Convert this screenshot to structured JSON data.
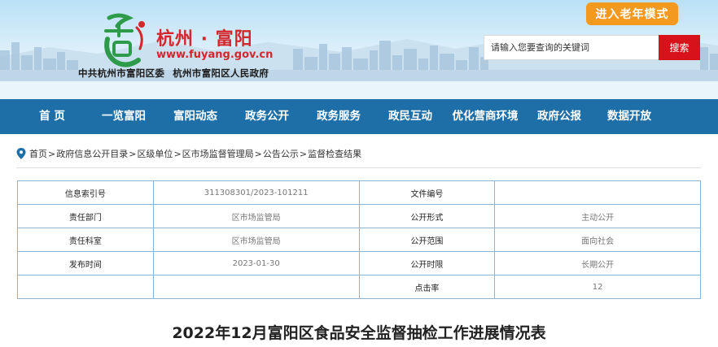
{
  "header": {
    "site_name": "杭州 · 富阳",
    "url": "www.fuyang.gov.cn",
    "orgs": [
      "中共杭州市富阳区委",
      "杭州市富阳区人民政府"
    ],
    "elder_mode_label": "进入老年模式",
    "search": {
      "placeholder": "请输入您要查询的关键词",
      "button_label": "搜索"
    }
  },
  "nav": {
    "items": [
      {
        "label": "首  页"
      },
      {
        "label": "一览富阳"
      },
      {
        "label": "富阳动态"
      },
      {
        "label": "政务公开"
      },
      {
        "label": "政务服务"
      },
      {
        "label": "政民互动"
      },
      {
        "label": "优化营商环境"
      },
      {
        "label": "政府公报"
      },
      {
        "label": "数据开放"
      }
    ]
  },
  "breadcrumb": {
    "items": [
      "首页",
      "政府信息公开目录",
      "区级单位",
      "区市场监督管理局",
      "公告公示",
      "监督检查结果"
    ],
    "separator": ">"
  },
  "info_table": {
    "rows": [
      {
        "label1": "信息索引号",
        "value1": "311308301/2023-101211",
        "label2": "文件编号",
        "value2": ""
      },
      {
        "label1": "责任部门",
        "value1": "区市场监管局",
        "label2": "公开形式",
        "value2": "主动公开"
      },
      {
        "label1": "责任科室",
        "value1": "区市场监管局",
        "label2": "公开范围",
        "value2": "面向社会"
      },
      {
        "label1": "发布时间",
        "value1": "2023-01-30",
        "label2": "公开时限",
        "value2": "长期公开"
      },
      {
        "label1": "",
        "value1": "",
        "label2": "点击率",
        "value2": "12"
      }
    ]
  },
  "document": {
    "title": "2022年12月富阳区食品安全监督抽检工作进展情况表"
  },
  "colors": {
    "nav_bg": "#1e6fa8",
    "brand_red": "#d5262b",
    "search_button": "#d8121b",
    "elder_button": "#f39a1e",
    "table_border": "#8fb4d2"
  },
  "icons": {
    "logo": "fuyang-logo-icon",
    "breadcrumb": "location-pin-icon"
  }
}
